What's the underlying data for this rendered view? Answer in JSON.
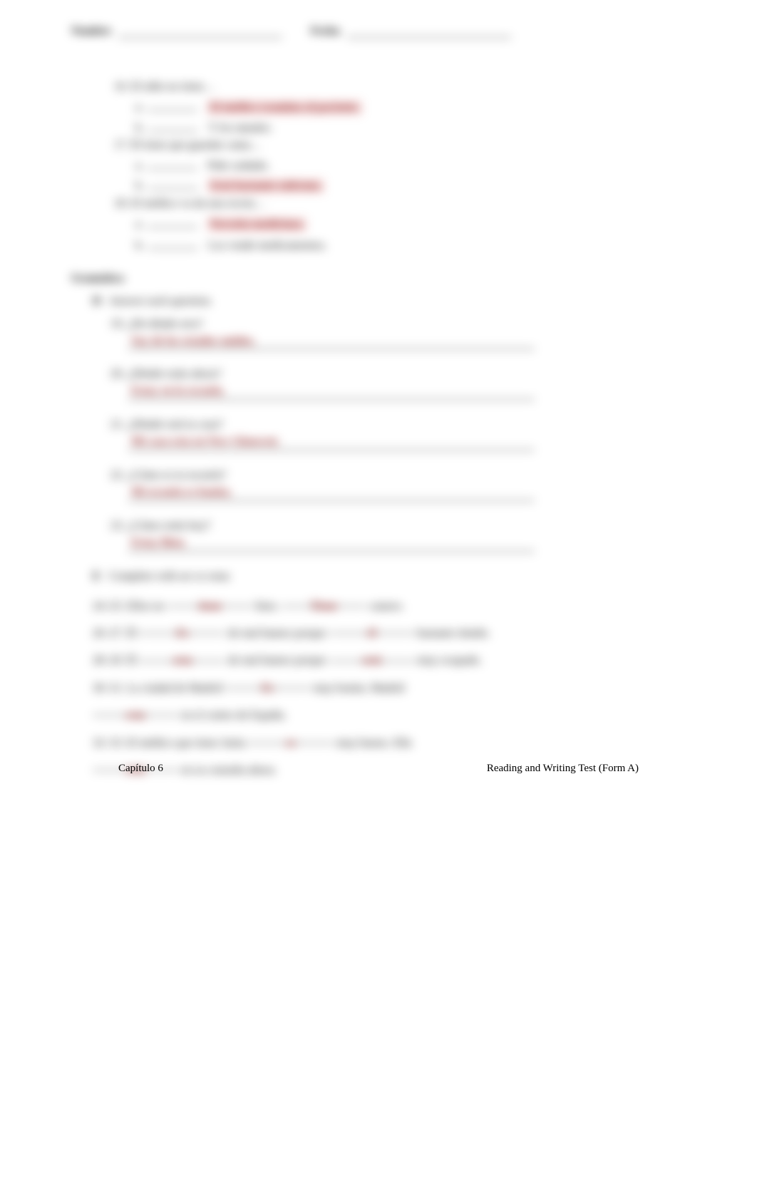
{
  "header": {
    "name_label": "Nombre",
    "date_label": "Fecha"
  },
  "reading": {
    "items": [
      {
        "num": "16.",
        "prompt": "El niño no tiene…",
        "options": [
          {
            "let": "a.",
            "answer": "El médico examina al paciente."
          },
          {
            "let": "b.",
            "plain": "Y los tamales."
          }
        ]
      },
      {
        "num": "17.",
        "prompt": "Él tiene que guardar cama…",
        "options": [
          {
            "let": "a.",
            "plain": "Pide cuidado."
          },
          {
            "let": "b.",
            "answer": "Está bastante enfermo."
          }
        ]
      },
      {
        "num": "18.",
        "prompt": "El médico va da una receta…",
        "options": [
          {
            "let": "a.",
            "answer": "Necesita medicinas."
          },
          {
            "let": "b.",
            "plain": "Los vende medicamentos."
          }
        ]
      }
    ]
  },
  "gramatica": {
    "heading": "Gramática",
    "partD": {
      "label": "D",
      "instr": "Answer each question.",
      "qs": [
        {
          "num": "19.",
          "q": "¿De dónde eres?",
          "a": "Soy de los estados unidos."
        },
        {
          "num": "20.",
          "q": "¿Dónde estás ahora?",
          "a": "Estoy en la escuela."
        },
        {
          "num": "21.",
          "q": "¿Dónde está tu casa?",
          "a": "Mi casa esta en New Glouwstr."
        },
        {
          "num": "22.",
          "q": "¿Cómo es tu escuela?",
          "a": "Mi escuela es bonita."
        },
        {
          "num": "23.",
          "q": "¿Cómo estás hoy?",
          "a": "Estoy Bien."
        }
      ]
    },
    "partE": {
      "label": "E",
      "instr": "Complete with ser or estar.",
      "lines": [
        {
          "pre": "24–25. Ellos no ",
          "b1": "tiene",
          "mid1": " bien. ",
          "b2": "Tiene",
          "post": " catarro."
        },
        {
          "pre": "26–27. Él ",
          "b1": "Es",
          "mid1": " de mal humor porque ",
          "b2": "él",
          "post": " bastante tímido."
        },
        {
          "pre": "28–29. Él ",
          "b1": "esta",
          "mid1": " de mal humor porque ",
          "b2": "está",
          "post": " muy ocupado."
        },
        {
          "pre": "30–31. La ciudad de Madrid ",
          "b1": "Es",
          "mid1": " muy bonita. Madrid ",
          "b2": "",
          "wrap": true,
          "b3": "esta",
          "post2": " en el centro de España."
        },
        {
          "pre": "32–33. El médico que tiene Anita ",
          "b1": "es",
          "mid1": " muy bueno. Ella ",
          "b2": "",
          "wrap": true,
          "b3": "esta",
          "post2": " en su consulta ahora."
        }
      ]
    }
  },
  "footer": {
    "left": "Capítulo 6",
    "right_a": "Reading and Writing Test ",
    "right_b": "(Form A)"
  }
}
